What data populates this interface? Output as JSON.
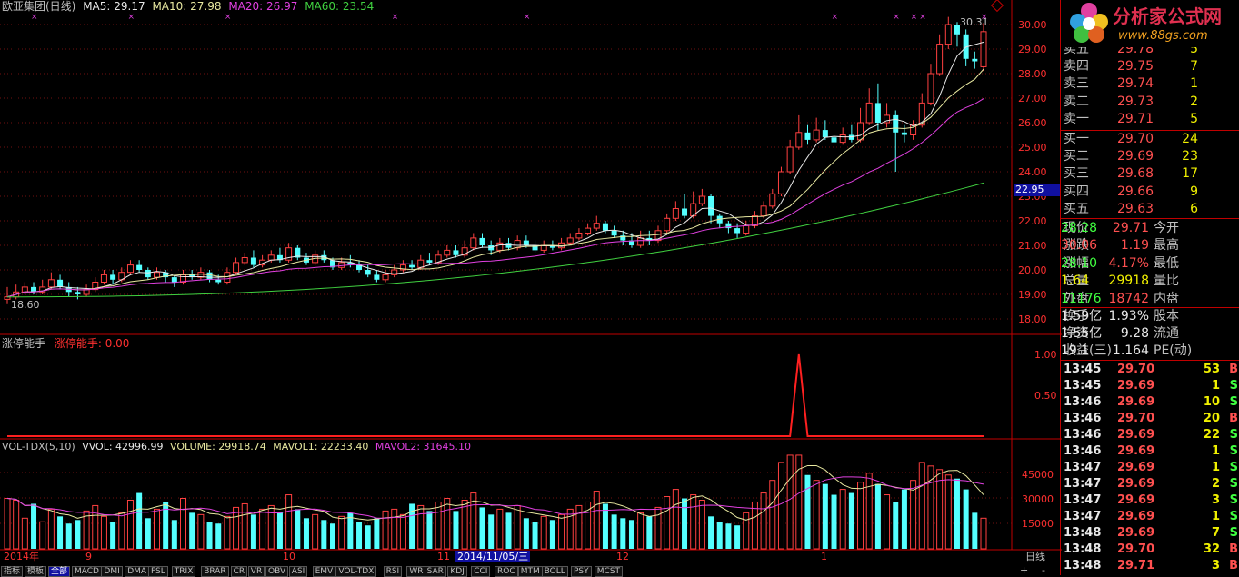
{
  "header": {
    "title": "欧亚集团(日线)",
    "ma5": "MA5: 29.17",
    "ma10": "MA10: 27.98",
    "ma20": "MA20: 26.97",
    "ma60": "MA60: 23.54"
  },
  "price_axis": [
    "30.00",
    "29.00",
    "28.00",
    "27.00",
    "26.00",
    "25.00",
    "24.00",
    "23.00",
    "22.00",
    "21.00",
    "20.00",
    "19.00",
    "18.00"
  ],
  "price_marker": "22.95",
  "high_label": "30.31",
  "low_label": "18.60",
  "indicator": {
    "name": "涨停能手",
    "value_label": "涨停能手: 0.00",
    "axis": [
      "1.00",
      "0.50"
    ]
  },
  "volume": {
    "header": "VOL-TDX(5,10)",
    "vvol": "VVOL: 42996.99",
    "vol": "VOLUME: 29918.74",
    "mavol1": "MAVOL1: 22233.40",
    "mavol2": "MAVOL2: 31645.10",
    "axis": [
      "45000",
      "30000",
      "15000"
    ]
  },
  "time_axis": {
    "labels": [
      "2014年",
      "9",
      "10",
      "11",
      "12",
      "1"
    ],
    "highlight": "2014/11/05/三",
    "period": "日线"
  },
  "bottom_tabs": [
    "指标",
    "模板",
    "全部",
    "MACD",
    "DMI",
    "DMA",
    "FSL",
    "TRIX",
    "BRAR",
    "CR",
    "VR",
    "OBV",
    "ASI",
    "EMV",
    "VOL-TDX",
    "RSI",
    "WR",
    "SAR",
    "KDJ",
    "CCI",
    "ROC",
    "MTM",
    "BOLL",
    "PSY",
    "MCST"
  ],
  "bottom_right": [
    "+",
    "-"
  ],
  "logo": {
    "name": "分析家公式网",
    "url": "www.88gs.com"
  },
  "order_book": {
    "asks": [
      {
        "label": "卖五",
        "price": "29.78",
        "vol": "5"
      },
      {
        "label": "卖四",
        "price": "29.75",
        "vol": "7"
      },
      {
        "label": "卖三",
        "price": "29.74",
        "vol": "1"
      },
      {
        "label": "卖二",
        "price": "29.73",
        "vol": "2"
      },
      {
        "label": "卖一",
        "price": "29.71",
        "vol": "5"
      }
    ],
    "bids": [
      {
        "label": "买一",
        "price": "29.70",
        "vol": "24"
      },
      {
        "label": "买二",
        "price": "29.69",
        "vol": "23"
      },
      {
        "label": "买三",
        "price": "29.68",
        "vol": "17"
      },
      {
        "label": "买四",
        "price": "29.66",
        "vol": "9"
      },
      {
        "label": "买五",
        "price": "29.63",
        "vol": "6"
      }
    ]
  },
  "quote": [
    {
      "l1": "现价",
      "v1": "29.71",
      "l2": "今开",
      "v2": "28.28"
    },
    {
      "l1": "涨跌",
      "v1": "1.19",
      "l2": "最高",
      "v2": "30.06"
    },
    {
      "l1": "涨幅",
      "v1": "4.17%",
      "l2": "最低",
      "v2": "28.10"
    },
    {
      "l1": "总量",
      "v1": "29918",
      "l2": "量比",
      "v2": "1.64"
    },
    {
      "l1": "外盘",
      "v1": "18742",
      "l2": "内盘",
      "v2": "11176"
    }
  ],
  "fundamentals": [
    {
      "l1": "换手",
      "v1": "1.93%",
      "l2": "股本",
      "v2": "1.59亿"
    },
    {
      "l1": "净资",
      "v1": "9.28",
      "l2": "流通",
      "v2": "1.55亿"
    },
    {
      "l1": "收益(三)",
      "v1": "1.164",
      "l2": "PE(动)",
      "v2": "19.1"
    }
  ],
  "ticks": [
    {
      "time": "13:45",
      "price": "29.70",
      "vol": "53",
      "side": "B"
    },
    {
      "time": "13:45",
      "price": "29.69",
      "vol": "1",
      "side": "S"
    },
    {
      "time": "13:46",
      "price": "29.69",
      "vol": "10",
      "side": "S"
    },
    {
      "time": "13:46",
      "price": "29.70",
      "vol": "20",
      "side": "B"
    },
    {
      "time": "13:46",
      "price": "29.69",
      "vol": "22",
      "side": "S"
    },
    {
      "time": "13:46",
      "price": "29.69",
      "vol": "1",
      "side": "S"
    },
    {
      "time": "13:47",
      "price": "29.69",
      "vol": "1",
      "side": "S"
    },
    {
      "time": "13:47",
      "price": "29.69",
      "vol": "2",
      "side": "S"
    },
    {
      "time": "13:47",
      "price": "29.69",
      "vol": "3",
      "side": "S"
    },
    {
      "time": "13:47",
      "price": "29.69",
      "vol": "1",
      "side": "S"
    },
    {
      "time": "13:48",
      "price": "29.69",
      "vol": "7",
      "side": "S"
    },
    {
      "time": "13:48",
      "price": "29.70",
      "vol": "32",
      "side": "B"
    },
    {
      "time": "13:48",
      "price": "29.71",
      "vol": "3",
      "side": "B"
    }
  ],
  "chart_data": {
    "type": "candlestick",
    "price_range": [
      17.7,
      30.5
    ],
    "candles": [
      [
        18.8,
        18.9,
        19.3,
        18.6
      ],
      [
        18.9,
        19.1,
        19.4,
        18.8
      ],
      [
        19.1,
        19.3,
        19.5,
        19.0
      ],
      [
        19.3,
        19.1,
        19.5,
        19.0
      ],
      [
        19.1,
        19.3,
        19.6,
        19.0
      ],
      [
        19.3,
        19.6,
        19.9,
        19.2
      ],
      [
        19.6,
        19.3,
        19.8,
        19.2
      ],
      [
        19.3,
        19.1,
        19.5,
        18.9
      ],
      [
        19.1,
        19.0,
        19.3,
        18.8
      ],
      [
        19.0,
        19.2,
        19.4,
        18.9
      ],
      [
        19.2,
        19.5,
        19.7,
        19.1
      ],
      [
        19.5,
        19.8,
        20.0,
        19.4
      ],
      [
        19.8,
        19.6,
        20.0,
        19.4
      ],
      [
        19.6,
        19.9,
        20.1,
        19.5
      ],
      [
        19.9,
        20.2,
        20.4,
        19.8
      ],
      [
        20.2,
        20.0,
        20.4,
        19.9
      ],
      [
        20.0,
        19.7,
        20.1,
        19.6
      ],
      [
        19.7,
        19.9,
        20.1,
        19.6
      ],
      [
        19.9,
        19.7,
        20.0,
        19.5
      ],
      [
        19.7,
        19.5,
        19.8,
        19.3
      ],
      [
        19.5,
        19.8,
        20.0,
        19.4
      ],
      [
        19.8,
        19.7,
        20.0,
        19.6
      ],
      [
        19.7,
        19.9,
        20.1,
        19.6
      ],
      [
        19.9,
        19.6,
        20.0,
        19.5
      ],
      [
        19.6,
        19.5,
        19.8,
        19.4
      ],
      [
        19.5,
        19.9,
        20.1,
        19.4
      ],
      [
        19.9,
        20.3,
        20.5,
        19.8
      ],
      [
        20.3,
        20.5,
        20.7,
        20.2
      ],
      [
        20.5,
        20.2,
        20.8,
        20.1
      ],
      [
        20.2,
        20.4,
        20.6,
        20.1
      ],
      [
        20.4,
        20.6,
        20.8,
        20.3
      ],
      [
        20.6,
        20.4,
        20.9,
        20.3
      ],
      [
        20.4,
        20.9,
        21.1,
        20.3
      ],
      [
        20.9,
        20.5,
        21.0,
        20.4
      ],
      [
        20.5,
        20.3,
        20.7,
        20.2
      ],
      [
        20.3,
        20.6,
        20.8,
        20.2
      ],
      [
        20.6,
        20.4,
        20.8,
        20.3
      ],
      [
        20.4,
        20.1,
        20.5,
        20.0
      ],
      [
        20.1,
        20.3,
        20.5,
        20.0
      ],
      [
        20.3,
        20.2,
        20.6,
        20.1
      ],
      [
        20.2,
        20.0,
        20.4,
        19.9
      ],
      [
        20.0,
        19.8,
        20.2,
        19.7
      ],
      [
        19.8,
        19.6,
        20.0,
        19.5
      ],
      [
        19.6,
        19.8,
        20.0,
        19.5
      ],
      [
        19.8,
        20.0,
        20.2,
        19.7
      ],
      [
        20.0,
        20.2,
        20.4,
        19.9
      ],
      [
        20.2,
        20.1,
        20.4,
        20.0
      ],
      [
        20.1,
        20.4,
        20.6,
        20.0
      ],
      [
        20.4,
        20.3,
        20.7,
        20.2
      ],
      [
        20.3,
        20.6,
        20.8,
        20.2
      ],
      [
        20.6,
        20.8,
        21.0,
        20.5
      ],
      [
        20.8,
        20.6,
        21.0,
        20.5
      ],
      [
        20.6,
        20.9,
        21.2,
        20.5
      ],
      [
        20.9,
        21.3,
        21.5,
        20.8
      ],
      [
        21.3,
        21.0,
        21.5,
        20.9
      ],
      [
        21.0,
        20.8,
        21.2,
        20.6
      ],
      [
        20.8,
        21.1,
        21.3,
        20.7
      ],
      [
        21.1,
        20.9,
        21.3,
        20.8
      ],
      [
        20.9,
        21.2,
        21.4,
        20.8
      ],
      [
        21.2,
        21.0,
        21.4,
        20.9
      ],
      [
        21.0,
        20.8,
        21.2,
        20.7
      ],
      [
        20.8,
        21.0,
        21.2,
        20.7
      ],
      [
        21.0,
        20.9,
        21.2,
        20.8
      ],
      [
        20.9,
        21.1,
        21.3,
        20.8
      ],
      [
        21.1,
        21.3,
        21.5,
        21.0
      ],
      [
        21.3,
        21.5,
        21.7,
        21.2
      ],
      [
        21.5,
        21.7,
        21.9,
        21.4
      ],
      [
        21.7,
        21.9,
        22.2,
        21.6
      ],
      [
        21.9,
        21.6,
        22.0,
        21.5
      ],
      [
        21.6,
        21.4,
        21.8,
        21.3
      ],
      [
        21.4,
        21.2,
        21.6,
        21.0
      ],
      [
        21.2,
        21.0,
        21.5,
        20.9
      ],
      [
        21.0,
        21.3,
        21.6,
        20.9
      ],
      [
        21.3,
        21.2,
        21.6,
        21.0
      ],
      [
        21.2,
        21.6,
        21.8,
        21.1
      ],
      [
        21.6,
        22.1,
        22.3,
        21.5
      ],
      [
        22.1,
        22.5,
        22.8,
        22.0
      ],
      [
        22.5,
        22.2,
        23.1,
        22.1
      ],
      [
        22.2,
        22.7,
        23.2,
        22.1
      ],
      [
        22.7,
        23.0,
        23.3,
        22.6
      ],
      [
        23.0,
        22.2,
        23.1,
        21.9
      ],
      [
        22.2,
        21.9,
        22.3,
        21.7
      ],
      [
        21.9,
        21.7,
        22.0,
        21.5
      ],
      [
        21.7,
        21.5,
        21.9,
        21.3
      ],
      [
        21.5,
        21.8,
        22.0,
        21.4
      ],
      [
        21.8,
        22.2,
        22.4,
        21.7
      ],
      [
        22.2,
        22.6,
        22.8,
        22.1
      ],
      [
        22.6,
        23.1,
        23.3,
        22.5
      ],
      [
        23.1,
        24.0,
        24.2,
        23.0
      ],
      [
        24.0,
        25.0,
        25.3,
        23.9
      ],
      [
        25.0,
        25.6,
        26.3,
        24.9
      ],
      [
        25.6,
        25.3,
        25.9,
        25.1
      ],
      [
        25.3,
        25.7,
        26.2,
        25.2
      ],
      [
        25.7,
        25.4,
        26.1,
        25.3
      ],
      [
        25.4,
        25.2,
        25.8,
        25.0
      ],
      [
        25.2,
        25.5,
        25.8,
        25.1
      ],
      [
        25.5,
        25.3,
        25.9,
        25.2
      ],
      [
        25.3,
        26.0,
        26.6,
        25.2
      ],
      [
        26.0,
        26.8,
        27.4,
        25.9
      ],
      [
        26.8,
        26.0,
        27.6,
        25.7
      ],
      [
        26.0,
        26.3,
        26.8,
        25.8
      ],
      [
        26.3,
        25.6,
        26.5,
        24.0
      ],
      [
        25.6,
        25.5,
        25.9,
        25.2
      ],
      [
        25.5,
        25.9,
        26.1,
        25.3
      ],
      [
        25.9,
        26.8,
        27.2,
        25.8
      ],
      [
        26.8,
        28.0,
        28.4,
        26.7
      ],
      [
        28.0,
        29.2,
        29.6,
        27.9
      ],
      [
        29.2,
        30.0,
        30.31,
        29.0
      ],
      [
        30.0,
        29.6,
        30.1,
        29.1
      ],
      [
        29.6,
        28.6,
        29.8,
        28.3
      ],
      [
        28.6,
        28.5,
        28.9,
        28.2
      ],
      [
        28.28,
        29.71,
        30.06,
        28.1
      ]
    ],
    "ma_labels": [
      "MA5",
      "MA10",
      "MA20",
      "MA60"
    ],
    "volume_values": [
      28000,
      27000,
      17000,
      25000,
      15000,
      22000,
      18000,
      14000,
      16000,
      21000,
      24000,
      18000,
      15000,
      20000,
      27000,
      31000,
      17000,
      22000,
      26000,
      16000,
      28000,
      20000,
      19000,
      15000,
      14000,
      18000,
      23000,
      25000,
      19000,
      22000,
      24000,
      20000,
      30000,
      22000,
      17000,
      19000,
      16000,
      14000,
      18000,
      20000,
      15000,
      13000,
      17000,
      21000,
      22000,
      19000,
      25000,
      24000,
      21000,
      26000,
      28000,
      21000,
      27000,
      31000,
      23000,
      19000,
      22000,
      20000,
      24000,
      17000,
      15000,
      18000,
      16000,
      19000,
      22000,
      24000,
      26000,
      32000,
      25000,
      19000,
      17000,
      16000,
      20000,
      18000,
      23000,
      29000,
      33000,
      28000,
      30000,
      27000,
      18000,
      15000,
      14000,
      13000,
      20000,
      26000,
      31000,
      38000,
      48000,
      52000,
      52000,
      41000,
      38000,
      36000,
      30000,
      33000,
      31000,
      37000,
      42000,
      36000,
      30000,
      26000,
      33000,
      38000,
      48000,
      46000,
      44000,
      41000,
      39000,
      33000,
      20000,
      17000,
      29918
    ],
    "indicator_values_note": "0 everywhere except a single spike to 1.00"
  }
}
